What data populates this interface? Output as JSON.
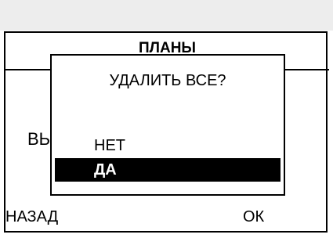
{
  "screen": {
    "title": "ПЛАНЫ",
    "background_item": "ВЫ",
    "softkeys": {
      "left": "НАЗАД",
      "right": "ОК"
    }
  },
  "dialog": {
    "title": "УДАЛИТЬ ВСЕ?",
    "options": [
      {
        "label": "НЕТ",
        "selected": false
      },
      {
        "label": "ДА",
        "selected": true
      }
    ]
  },
  "colors": {
    "selection_bg": "#000000",
    "selection_fg": "#ffffff",
    "top_bar": "#ededed"
  }
}
